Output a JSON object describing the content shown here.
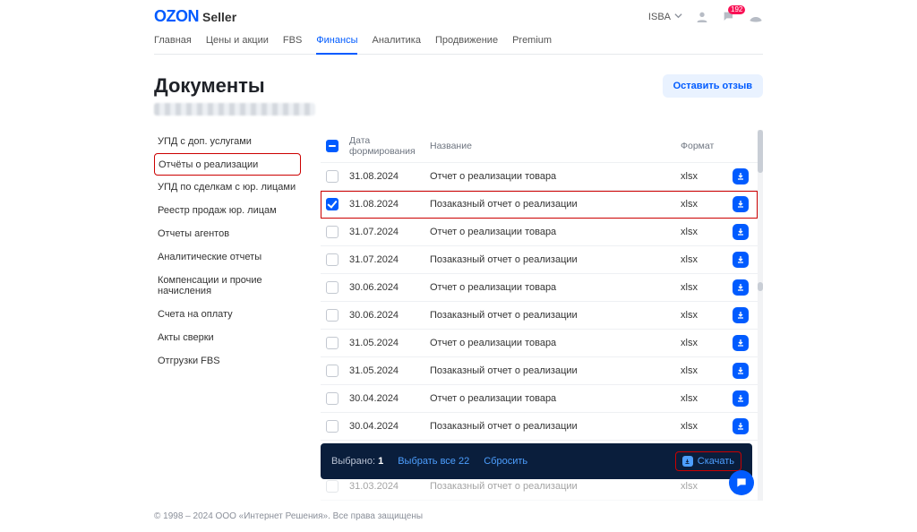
{
  "header": {
    "logo_ozon": "OZON",
    "logo_seller": "Seller",
    "account": "ISBA",
    "notif_count": "192"
  },
  "nav": {
    "items": [
      "Главная",
      "Цены и акции",
      "FBS",
      "Финансы",
      "Аналитика",
      "Продвижение",
      "Premium"
    ],
    "active_index": 3
  },
  "page": {
    "title": "Документы",
    "leave_review": "Оставить отзыв"
  },
  "sidebar": {
    "items": [
      "УПД с доп. услугами",
      "Отчёты о реализации",
      "УПД по сделкам с юр. лицами",
      "Реестр продаж юр. лицам",
      "Отчеты агентов",
      "Аналитические отчеты",
      "Компенсации и прочие начисления",
      "Счета на оплату",
      "Акты сверки",
      "Отгрузки FBS"
    ],
    "active_index": 1
  },
  "table": {
    "headers": {
      "date": "Дата формирования",
      "name": "Название",
      "format": "Формат"
    },
    "rows": [
      {
        "date": "31.08.2024",
        "name": "Отчет о реализации товара",
        "format": "xlsx",
        "checked": false,
        "highlighted": false
      },
      {
        "date": "31.08.2024",
        "name": "Позаказный отчет о реализации",
        "format": "xlsx",
        "checked": true,
        "highlighted": true
      },
      {
        "date": "31.07.2024",
        "name": "Отчет о реализации товара",
        "format": "xlsx",
        "checked": false,
        "highlighted": false
      },
      {
        "date": "31.07.2024",
        "name": "Позаказный отчет о реализации",
        "format": "xlsx",
        "checked": false,
        "highlighted": false
      },
      {
        "date": "30.06.2024",
        "name": "Отчет о реализации товара",
        "format": "xlsx",
        "checked": false,
        "highlighted": false
      },
      {
        "date": "30.06.2024",
        "name": "Позаказный отчет о реализации",
        "format": "xlsx",
        "checked": false,
        "highlighted": false
      },
      {
        "date": "31.05.2024",
        "name": "Отчет о реализации товара",
        "format": "xlsx",
        "checked": false,
        "highlighted": false
      },
      {
        "date": "31.05.2024",
        "name": "Позаказный отчет о реализации",
        "format": "xlsx",
        "checked": false,
        "highlighted": false
      },
      {
        "date": "30.04.2024",
        "name": "Отчет о реализации товара",
        "format": "xlsx",
        "checked": false,
        "highlighted": false
      },
      {
        "date": "30.04.2024",
        "name": "Позаказный отчет о реализации",
        "format": "xlsx",
        "checked": false,
        "highlighted": false
      }
    ],
    "faded_row": {
      "date": "31.03.2024",
      "name": "Позаказный отчет о реализации",
      "format": "xlsx"
    }
  },
  "selection_bar": {
    "selected_label": "Выбрано:",
    "selected_count": "1",
    "select_all": "Выбрать все 22",
    "reset": "Сбросить",
    "download": "Скачать"
  },
  "footer": "© 1998 – 2024 ООО «Интернет Решения». Все права защищены"
}
